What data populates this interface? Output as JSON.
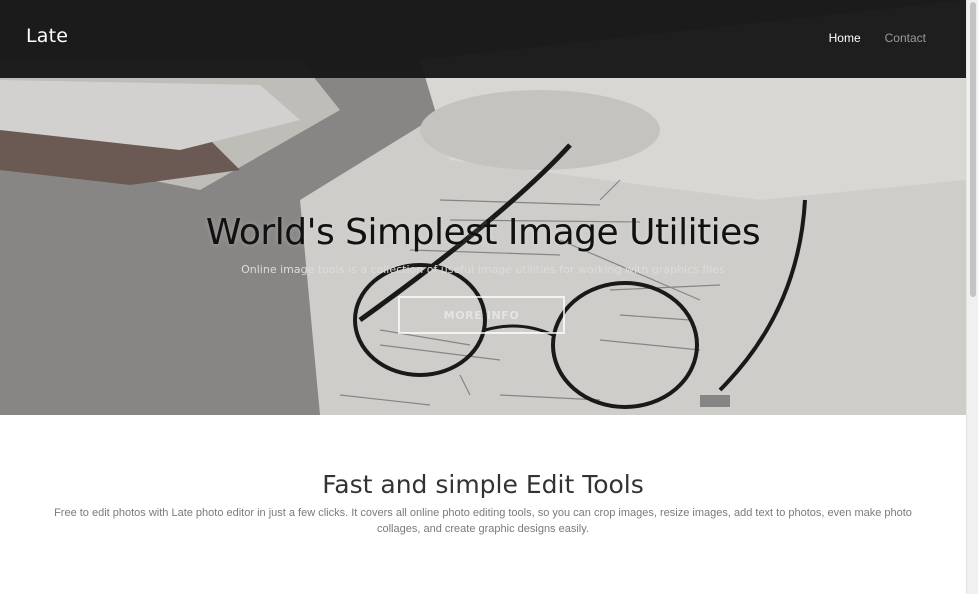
{
  "navbar": {
    "brand": "Late",
    "links": [
      {
        "label": "Home",
        "active": true
      },
      {
        "label": "Contact",
        "active": false
      }
    ]
  },
  "hero": {
    "title": "World's Simplest Image Utilities",
    "subtitle": "Online image tools is a collection of useful image utilities for working with graphics files",
    "button_label": "MORE INFO"
  },
  "features": {
    "title": "Fast and simple Edit Tools",
    "text": "Free to edit photos with Late photo editor in just a few clicks. It covers all online photo editing tools, so you can crop images, resize images, add text to photos, even make photo collages, and create graphic designs easily."
  },
  "colors": {
    "navbar_bg": "#181818",
    "nav_active": "#ffffff",
    "nav_inactive": "#9a9a9a",
    "heading": "#333333",
    "body_text": "#7a7a7a"
  }
}
